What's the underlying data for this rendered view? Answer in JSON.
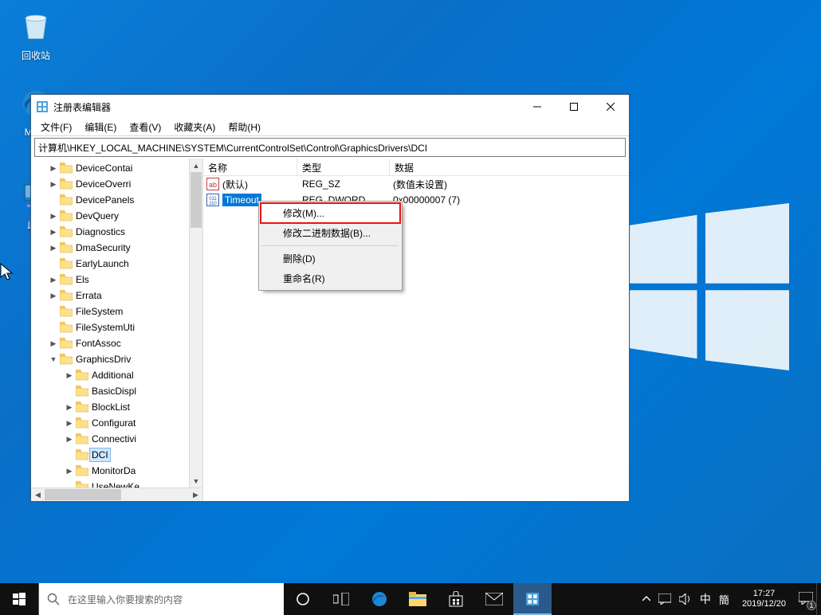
{
  "desktop": {
    "recycle_bin": "回收站",
    "edge": "Mic...",
    "thispc": "此..."
  },
  "window": {
    "title": "注册表编辑器",
    "menu": {
      "file": "文件(F)",
      "edit": "编辑(E)",
      "view": "查看(V)",
      "favorites": "收藏夹(A)",
      "help": "帮助(H)"
    },
    "address": "计算机\\HKEY_LOCAL_MACHINE\\SYSTEM\\CurrentControlSet\\Control\\GraphicsDrivers\\DCI"
  },
  "tree": {
    "items": [
      {
        "indent": 122,
        "twisty": ">",
        "label": "DeviceContai"
      },
      {
        "indent": 122,
        "twisty": ">",
        "label": "DeviceOverri"
      },
      {
        "indent": 122,
        "twisty": "",
        "label": "DevicePanels"
      },
      {
        "indent": 122,
        "twisty": ">",
        "label": "DevQuery"
      },
      {
        "indent": 122,
        "twisty": ">",
        "label": "Diagnostics"
      },
      {
        "indent": 122,
        "twisty": ">",
        "label": "DmaSecurity"
      },
      {
        "indent": 122,
        "twisty": "",
        "label": "EarlyLaunch"
      },
      {
        "indent": 122,
        "twisty": ">",
        "label": "Els"
      },
      {
        "indent": 122,
        "twisty": ">",
        "label": "Errata"
      },
      {
        "indent": 122,
        "twisty": "",
        "label": "FileSystem"
      },
      {
        "indent": 122,
        "twisty": "",
        "label": "FileSystemUti"
      },
      {
        "indent": 122,
        "twisty": ">",
        "label": "FontAssoc"
      },
      {
        "indent": 122,
        "twisty": "v",
        "label": "GraphicsDriv"
      },
      {
        "indent": 142,
        "twisty": ">",
        "label": "Additional"
      },
      {
        "indent": 142,
        "twisty": "",
        "label": "BasicDispl"
      },
      {
        "indent": 142,
        "twisty": ">",
        "label": "BlockList"
      },
      {
        "indent": 142,
        "twisty": ">",
        "label": "Configurat"
      },
      {
        "indent": 142,
        "twisty": ">",
        "label": "Connectivi"
      },
      {
        "indent": 142,
        "twisty": "",
        "label": "DCI",
        "selected": true
      },
      {
        "indent": 142,
        "twisty": ">",
        "label": "MonitorDa"
      },
      {
        "indent": 142,
        "twisty": "",
        "label": "UseNewKe"
      }
    ],
    "scroll_up_partial": "^"
  },
  "list": {
    "headers": {
      "name": "名称",
      "type": "类型",
      "data": "数据"
    },
    "rows": [
      {
        "icon": "sz",
        "name": "(默认)",
        "type": "REG_SZ",
        "data": "(数值未设置)"
      },
      {
        "icon": "dw",
        "name": "Timeout",
        "type": "REG_DWORD",
        "data": "0x00000007 (7)",
        "selected": true
      }
    ]
  },
  "context_menu": {
    "modify": "修改(M)...",
    "modify_binary": "修改二进制数据(B)...",
    "delete": "删除(D)",
    "rename": "重命名(R)"
  },
  "taskbar": {
    "search_placeholder": "在这里输入你要搜索的内容",
    "ime": "中",
    "ime2": "簡",
    "time": "17:27",
    "date": "2019/12/20",
    "notif_count": "1"
  }
}
